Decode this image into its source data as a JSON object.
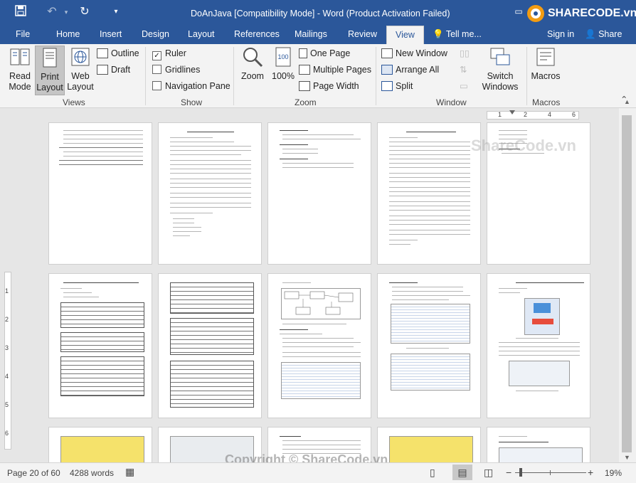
{
  "title_bar": {
    "save_icon": "save-icon",
    "undo_icon": "undo-icon",
    "redo_icon": "redo-icon",
    "customize_icon": "chevron-down-icon",
    "title": "DoAnJava [Compatibility Mode] - Word (Product Activation Failed)",
    "ribbon_display_icon": "ribbon-display-icon",
    "minimize": "—",
    "maximize": "☐",
    "close": "✕"
  },
  "tabs": [
    "File",
    "Home",
    "Insert",
    "Design",
    "Layout",
    "References",
    "Mailings",
    "Review",
    "View"
  ],
  "active_tab": "View",
  "tell_me": "Tell me...",
  "sign_in": "Sign in",
  "share": "Share",
  "ribbon": {
    "views": {
      "label": "Views",
      "read_mode": "Read Mode",
      "print_layout": "Print Layout",
      "web_layout": "Web Layout",
      "outline": "Outline",
      "draft": "Draft"
    },
    "show": {
      "label": "Show",
      "ruler": "Ruler",
      "ruler_checked": true,
      "gridlines": "Gridlines",
      "gridlines_checked": false,
      "navigation_pane": "Navigation Pane",
      "navigation_pane_checked": false
    },
    "zoom": {
      "label": "Zoom",
      "zoom": "Zoom",
      "hundred": "100%",
      "one_page": "One Page",
      "multiple_pages": "Multiple Pages",
      "page_width": "Page Width"
    },
    "window": {
      "label": "Window",
      "new_window": "New Window",
      "arrange_all": "Arrange All",
      "split": "Split",
      "switch_windows": "Switch Windows"
    },
    "macros": {
      "label": "Macros",
      "macros": "Macros"
    }
  },
  "ruler_numbers": [
    "1",
    "2",
    "4",
    "6"
  ],
  "vruler_numbers": [
    "1",
    "2",
    "3",
    "4",
    "5",
    "6"
  ],
  "status": {
    "page": "Page 20 of 60",
    "words": "4288 words",
    "zoom_minus": "−",
    "zoom_plus": "+",
    "zoom_level": "19%"
  },
  "watermarks": {
    "logo_text": "SHARECODE.vn",
    "site": "ShareCode.vn",
    "copyright": "Copyright © ShareCode.vn"
  },
  "colors": {
    "word_blue": "#2b579a",
    "ribbon_bg": "#f3f3f3",
    "doc_bg": "#e6e6e6"
  }
}
